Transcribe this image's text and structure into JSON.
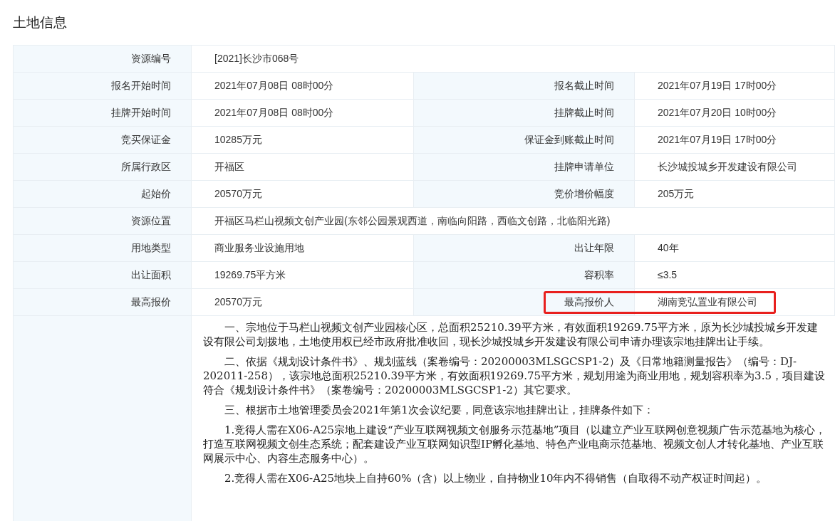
{
  "title": "土地信息",
  "rows": [
    {
      "cells": [
        {
          "label": "资源编号",
          "value": "[2021]长沙市068号"
        }
      ]
    },
    {
      "cells": [
        {
          "label": "报名开始时间",
          "value": "2021年07月08日 08时00分"
        },
        {
          "label": "报名截止时间",
          "value": "2021年07月19日 17时00分"
        }
      ]
    },
    {
      "cells": [
        {
          "label": "挂牌开始时间",
          "value": "2021年07月08日 08时00分"
        },
        {
          "label": "挂牌截止时间",
          "value": "2021年07月20日 10时00分"
        }
      ]
    },
    {
      "cells": [
        {
          "label": "竞买保证金",
          "value": "10285万元"
        },
        {
          "label": "保证金到账截止时间",
          "value": "2021年07月19日 17时00分"
        }
      ]
    },
    {
      "cells": [
        {
          "label": "所属行政区",
          "value": "开福区"
        },
        {
          "label": "挂牌申请单位",
          "value": "长沙城投城乡开发建设有限公司"
        }
      ]
    },
    {
      "cells": [
        {
          "label": "起始价",
          "value": "20570万元"
        },
        {
          "label": "竞价增价幅度",
          "value": "205万元"
        }
      ]
    },
    {
      "cells": [
        {
          "label": "资源位置",
          "value": "开福区马栏山视频文创产业园(东邻公园景观西道，南临向阳路，西临文创路，北临阳光路)"
        }
      ]
    },
    {
      "cells": [
        {
          "label": "用地类型",
          "value": "商业服务业设施用地"
        },
        {
          "label": "出让年限",
          "value": "40年"
        }
      ]
    },
    {
      "cells": [
        {
          "label": "出让面积",
          "value": "19269.75平方米"
        },
        {
          "label": "容积率",
          "value": "≤3.5"
        }
      ]
    },
    {
      "cells": [
        {
          "label": "最高报价",
          "value": "20570万元"
        },
        {
          "label": "最高报价人",
          "value": "湖南竞弘置业有限公司",
          "highlighted": true
        }
      ]
    }
  ],
  "paragraphs": [
    "一、宗地位于马栏山视频文创产业园核心区，总面积25210.39平方米，有效面积19269.75平方米，原为长沙城投城乡开发建设有限公司划拨地，土地使用权已经市政府批准收回，现长沙城投城乡开发建设有限公司申请办理该宗地挂牌出让手续。",
    "二、依据《规划设计条件书》、规划蓝线（案卷编号：20200003MLSGCSP1-2）及《日常地籍测量报告》（编号：DJ-202011-258），该宗地总面积25210.39平方米，有效面积19269.75平方米，规划用途为商业用地，规划容积率为3.5，项目建设符合《规划设计条件书》（案卷编号：20200003MLSGCSP1-2）其它要求。",
    "三、根据市土地管理委员会2021年第1次会议纪要，同意该宗地挂牌出让，挂牌条件如下：",
    "1.竞得人需在X06-A25宗地上建设“产业互联网视频文创服务示范基地”项目（以建立产业互联网创意视频广告示范基地为核心，打造互联网视频文创生态系统；配套建设产业互联网知识型IP孵化基地、特色产业电商示范基地、视频文创人才转化基地、产业互联网展示中心、内容生态服务中心）。",
    "2.竞得人需在X06-A25地块上自持60%（含）以上物业，自持物业10年内不得销售（自取得不动产权证时间起）。"
  ]
}
